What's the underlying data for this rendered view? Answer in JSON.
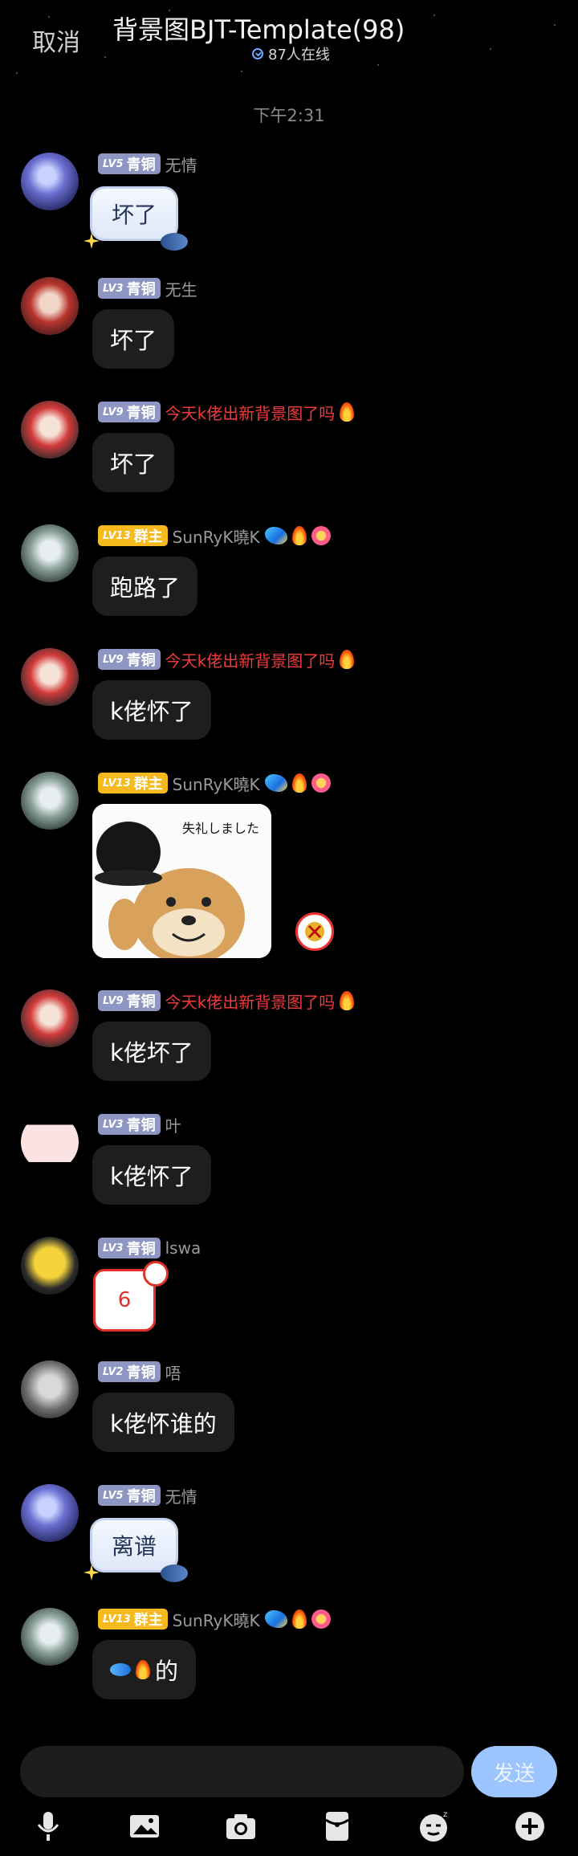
{
  "header": {
    "cancel_label": "取消",
    "title": "背景图BJT-Template(98)",
    "online_text": "87人在线"
  },
  "timestamp": "下午2:31",
  "messages": [
    {
      "badge_level": "LV5",
      "badge_title": "青铜",
      "nickname": "无情",
      "text": "坏了"
    },
    {
      "badge_level": "LV3",
      "badge_title": "青铜",
      "nickname": "无生",
      "text": "坏了"
    },
    {
      "badge_level": "LV9",
      "badge_title": "青铜",
      "nickname": "今天k佬出新背景图了吗",
      "text": "坏了"
    },
    {
      "badge_level": "LV13",
      "badge_title": "群主",
      "nickname": "SunRyK曉K",
      "text": "跑路了"
    },
    {
      "badge_level": "LV9",
      "badge_title": "青铜",
      "nickname": "今天k佬出新背景图了吗",
      "text": "k佬怀了"
    },
    {
      "badge_level": "LV13",
      "badge_title": "群主",
      "nickname": "SunRyK曉K",
      "image_caption": "失礼しました"
    },
    {
      "badge_level": "LV9",
      "badge_title": "青铜",
      "nickname": "今天k佬出新背景图了吗",
      "text": "k佬坏了"
    },
    {
      "badge_level": "LV3",
      "badge_title": "青铜",
      "nickname": "叶",
      "text": "k佬怀了"
    },
    {
      "badge_level": "LV3",
      "badge_title": "青铜",
      "nickname": "lswa",
      "text": "6"
    },
    {
      "badge_level": "LV2",
      "badge_title": "青铜",
      "nickname": "唔",
      "text": "k佬怀谁的"
    },
    {
      "badge_level": "LV5",
      "badge_title": "青铜",
      "nickname": "无情",
      "text": "离谱"
    },
    {
      "badge_level": "LV13",
      "badge_title": "群主",
      "nickname": "SunRyK曉K",
      "text": "的"
    }
  ],
  "composer": {
    "send_label": "发送",
    "tools": [
      "microphone-icon",
      "image-icon",
      "camera-icon",
      "red-packet-icon",
      "emoji-icon",
      "plus-icon"
    ]
  },
  "colors": {
    "background": "#000000",
    "bubble": "#1e1e1e",
    "badge_bronze": "#8e97c4",
    "badge_owner": "#f6b91e",
    "nickname_red": "#f03a3a",
    "send_button": "#9cc5ff"
  }
}
